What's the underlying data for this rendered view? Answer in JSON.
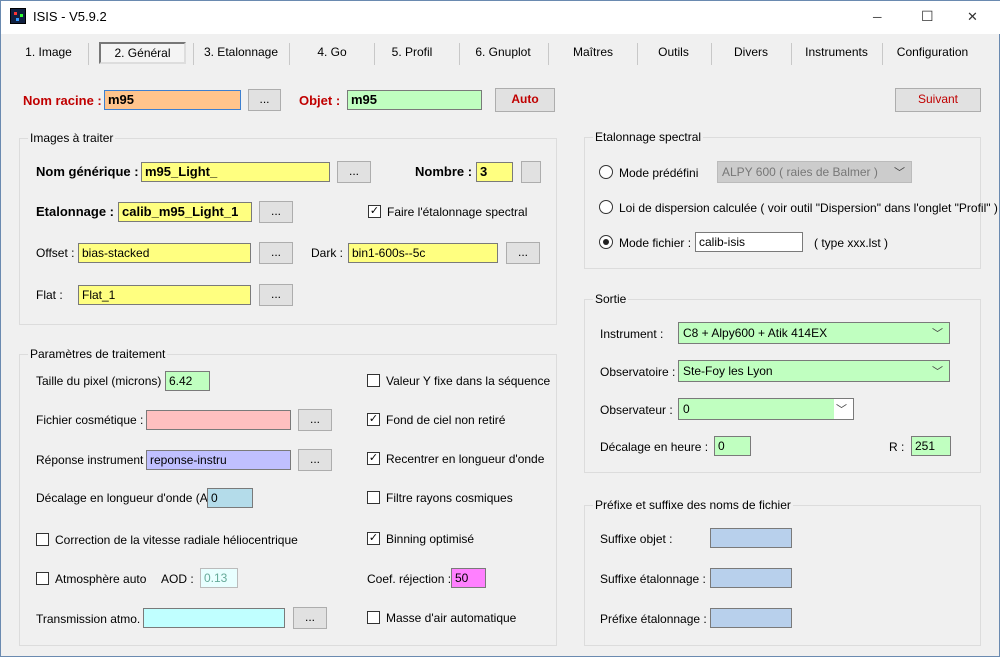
{
  "window": {
    "title": "ISIS - V5.9.2",
    "minimize": "─",
    "maximize": "☐",
    "close": "✕"
  },
  "tabs": [
    "1. Image",
    "2. Général",
    "3. Etalonnage",
    "4. Go",
    "5. Profil",
    "6. Gnuplot",
    "Maîtres",
    "Outils",
    "Divers",
    "Instruments",
    "Configuration"
  ],
  "top": {
    "nom_racine_label": "Nom racine :",
    "nom_racine_value": "m95",
    "browse": "...",
    "objet_label": "Objet :",
    "objet_value": "m95",
    "auto": "Auto",
    "suivant": "Suivant"
  },
  "images": {
    "title": "Images à traiter",
    "nom_generique_label": "Nom générique :",
    "nom_generique_value": "m95_Light_",
    "nombre_label": "Nombre :",
    "nombre_value": "3",
    "etalonnage_label": "Etalonnage :",
    "etalonnage_value": "calib_m95_Light_1",
    "faire_etalonnage": "Faire l'étalonnage spectral",
    "faire_etalonnage_checked": true,
    "offset_label": "Offset :",
    "offset_value": "bias-stacked",
    "dark_label": "Dark :",
    "dark_value": "bin1-600s--5c",
    "flat_label": "Flat :",
    "flat_value": "Flat_1",
    "browse": "..."
  },
  "params": {
    "title": "Paramètres de traitement",
    "taille_pixel_label": "Taille du pixel (microns) :",
    "taille_pixel_value": "6.42",
    "cosmetique_label": "Fichier cosmétique :",
    "cosmetique_value": "",
    "reponse_label": "Réponse instrument :",
    "reponse_value": "reponse-instru",
    "decalage_label": "Décalage en longueur d'onde (A) :",
    "decalage_value": "0",
    "correction_vitesse": "Correction de la vitesse radiale héliocentrique",
    "atmosphere_auto": "Atmosphère auto",
    "aod_label": "AOD :",
    "aod_value": "0.13",
    "transmission_label": "Transmission atmo. :",
    "transmission_value": "",
    "valeur_y_fixe": "Valeur Y fixe dans la séquence",
    "fond_ciel": "Fond de ciel non retiré",
    "recentrer": "Recentrer en longueur d'onde",
    "filtre_cosmiques": "Filtre rayons cosmiques",
    "binning": "Binning optimisé",
    "coef_rejection_label": "Coef. réjection :",
    "coef_rejection_value": "50",
    "masse_air": "Masse d'air automatique",
    "browse": "...",
    "checked": {
      "correction_vitesse": false,
      "atmosphere_auto": false,
      "valeur_y_fixe": false,
      "fond_ciel": true,
      "recentrer": true,
      "filtre_cosmiques": false,
      "binning": true,
      "masse_air": false
    }
  },
  "etal_spectral": {
    "title": "Etalonnage spectral",
    "mode_predefini": "Mode prédéfini",
    "mode_predefini_select": "ALPY 600 ( raies de Balmer )",
    "loi_dispersion": "Loi de dispersion calculée ( voir outil \"Dispersion\" dans l'onglet \"Profil\" )",
    "mode_fichier": "Mode fichier :",
    "mode_fichier_value": "calib-isis",
    "type_hint": "( type xxx.lst )",
    "selected": "mode_fichier"
  },
  "sortie": {
    "title": "Sortie",
    "instrument_label": "Instrument :",
    "instrument_value": "C8 + Alpy600 + Atik 414EX",
    "observatoire_label": "Observatoire :",
    "observatoire_value": "Ste-Foy les Lyon",
    "observateur_label": "Observateur :",
    "observateur_value": "0",
    "decalage_heure_label": "Décalage en heure :",
    "decalage_heure_value": "0",
    "r_label": "R :",
    "r_value": "251"
  },
  "prefixe": {
    "title": "Préfixe et suffixe des noms de fichier",
    "suffixe_objet_label": "Suffixe objet :",
    "suffixe_objet_value": "",
    "suffixe_etal_label": "Suffixe étalonnage :",
    "suffixe_etal_value": "",
    "prefixe_etal_label": "Préfixe étalonnage :",
    "prefixe_etal_value": ""
  },
  "colors": {
    "orange": "#ffc48c",
    "green": "#c0ffc0",
    "yellow": "#ffff80",
    "pink": "#ffc0c0",
    "lavender": "#c0c0ff",
    "lightblue": "#b4dcea",
    "cyan": "#c0ffff",
    "magenta": "#ff80ff",
    "suffix": "#b8d0ec"
  }
}
